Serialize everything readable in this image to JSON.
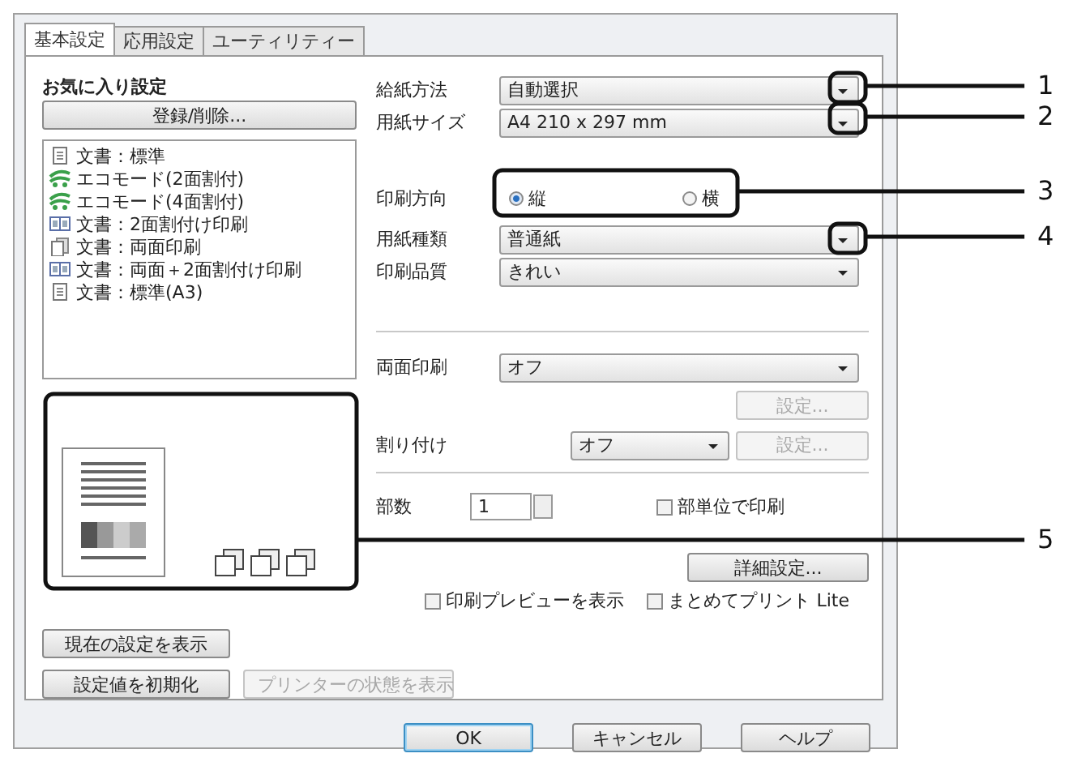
{
  "tabs": [
    {
      "label": "基本設定",
      "selected": true
    },
    {
      "label": "応用設定",
      "selected": false
    },
    {
      "label": "ユーティリティー",
      "selected": false
    }
  ],
  "favorites": {
    "heading": "お気に入り設定",
    "register_button": "登録/削除...",
    "items": [
      {
        "kind": "document",
        "label": "文書：標準"
      },
      {
        "kind": "eco",
        "label": "エコモード(2面割付)"
      },
      {
        "kind": "eco",
        "label": "エコモード(4面割付)"
      },
      {
        "kind": "nup",
        "label": "文書：2面割付け印刷"
      },
      {
        "kind": "duplex",
        "label": "文書：両面印刷"
      },
      {
        "kind": "nup",
        "label": "文書：両面＋2面割付け印刷"
      },
      {
        "kind": "document",
        "label": "文書：標準(A3)"
      }
    ]
  },
  "paper_source": {
    "label": "給紙方法",
    "value": "自動選択"
  },
  "paper_size": {
    "label": "用紙サイズ",
    "value": "A4 210 x 297 mm"
  },
  "orientation": {
    "label": "印刷方向",
    "options": [
      {
        "label": "縦",
        "selected": true
      },
      {
        "label": "横",
        "selected": false
      }
    ]
  },
  "paper_type": {
    "label": "用紙種類",
    "value": "普通紙"
  },
  "quality": {
    "label": "印刷品質",
    "value": "きれい"
  },
  "duplex": {
    "label": "両面印刷",
    "value": "オフ",
    "settings_button": {
      "label": "設定...",
      "disabled": true
    }
  },
  "layout": {
    "label": "割り付け",
    "value": "オフ",
    "settings_button": {
      "label": "設定...",
      "disabled": true
    }
  },
  "copies": {
    "label": "部数",
    "value": "1",
    "collate": {
      "label": "部単位で印刷",
      "checked": false
    }
  },
  "advanced_button": "詳細設定...",
  "options": [
    {
      "label": "印刷プレビューを表示",
      "checked": false
    },
    {
      "label": "まとめてプリント Lite",
      "checked": false
    }
  ],
  "left_buttons": [
    {
      "label": "現在の設定を表示",
      "disabled": false
    },
    {
      "label": "設定値を初期化",
      "disabled": false
    },
    {
      "label": "プリンターの状態を表示",
      "disabled": true
    }
  ],
  "dialog_buttons": [
    {
      "label": "OK",
      "default": true
    },
    {
      "label": "キャンセル",
      "default": false
    },
    {
      "label": "ヘルプ",
      "default": false
    }
  ],
  "callouts": [
    {
      "label": "1"
    },
    {
      "label": "2"
    },
    {
      "label": "3"
    },
    {
      "label": "4"
    },
    {
      "label": "5"
    }
  ]
}
